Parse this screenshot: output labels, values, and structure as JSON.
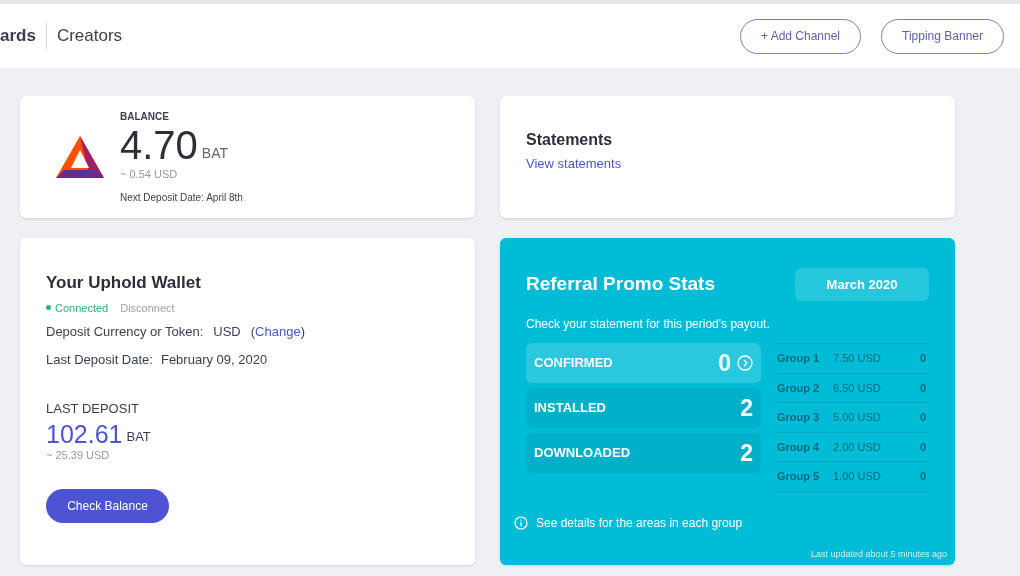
{
  "header": {
    "brand": "ards",
    "section": "Creators",
    "buttons": [
      "+ Add Channel",
      "Tipping Banner"
    ]
  },
  "balance": {
    "label": "BALANCE",
    "amount": "4.70",
    "unit": "BAT",
    "usd": "~ 0.54 USD",
    "next_deposit": "Next Deposit Date: April 8th"
  },
  "statements": {
    "title": "Statements",
    "link": "View statements"
  },
  "wallet": {
    "title": "Your Uphold Wallet",
    "status": "Connected",
    "connected": true,
    "disconnect": "Disconnect",
    "currency_label": "Deposit Currency or Token:",
    "currency": "USD",
    "change_open": "(",
    "change_link": "Change",
    "change_close": ")",
    "last_date_label": "Last Deposit Date:",
    "last_date": "February 09, 2020",
    "last_deposit_label": "LAST DEPOSIT",
    "last_amount": "102.61",
    "last_unit": "BAT",
    "last_usd": "~ 25.39 USD",
    "button": "Check Balance"
  },
  "referral": {
    "title": "Referral Promo Stats",
    "period": "March 2020",
    "subtitle": "Check your statement for this period's payout.",
    "stats": [
      {
        "label": "CONFIRMED",
        "value": "0",
        "selected": true
      },
      {
        "label": "INSTALLED",
        "value": "2",
        "selected": false
      },
      {
        "label": "DOWNLOADED",
        "value": "2",
        "selected": false
      }
    ],
    "groups": [
      {
        "name": "Group 1",
        "amount": "7.50 USD",
        "count": "0"
      },
      {
        "name": "Group 2",
        "amount": "6.50 USD",
        "count": "0"
      },
      {
        "name": "Group 3",
        "amount": "5.00 USD",
        "count": "0"
      },
      {
        "name": "Group 4",
        "amount": "2.00 USD",
        "count": "0"
      },
      {
        "name": "Group 5",
        "amount": "1.00 USD",
        "count": "0"
      }
    ],
    "details": "See details for the areas in each group",
    "updated": "Last updated about 5 minutes ago"
  }
}
